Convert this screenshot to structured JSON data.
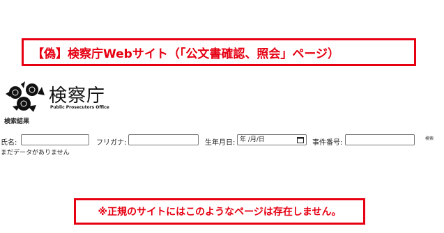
{
  "warning_banner": {
    "text": "【偽】検察庁Webサイト（「公文書確認、照会」ページ）",
    "color": "#e60012"
  },
  "logo": {
    "name": "検察庁",
    "subtitle": "Public Prosecutors Office",
    "emblem_icon": "chrysanthemum-emblem-icon"
  },
  "page": {
    "section_title": "検索結果",
    "no_data_message": "まだデータがありません"
  },
  "search_form": {
    "name_label": "氏名:",
    "name_value": "",
    "furigana_label": "フリガナ:",
    "furigana_value": "",
    "birthdate_label": "生年月日:",
    "birthdate_placeholder": "年 /月/日",
    "case_number_label": "事件番号:",
    "case_number_value": "",
    "search_button_label": "検索"
  },
  "notice": {
    "text": "※正規のサイトにはこのようなページは存在しません。",
    "color": "#e60012"
  }
}
